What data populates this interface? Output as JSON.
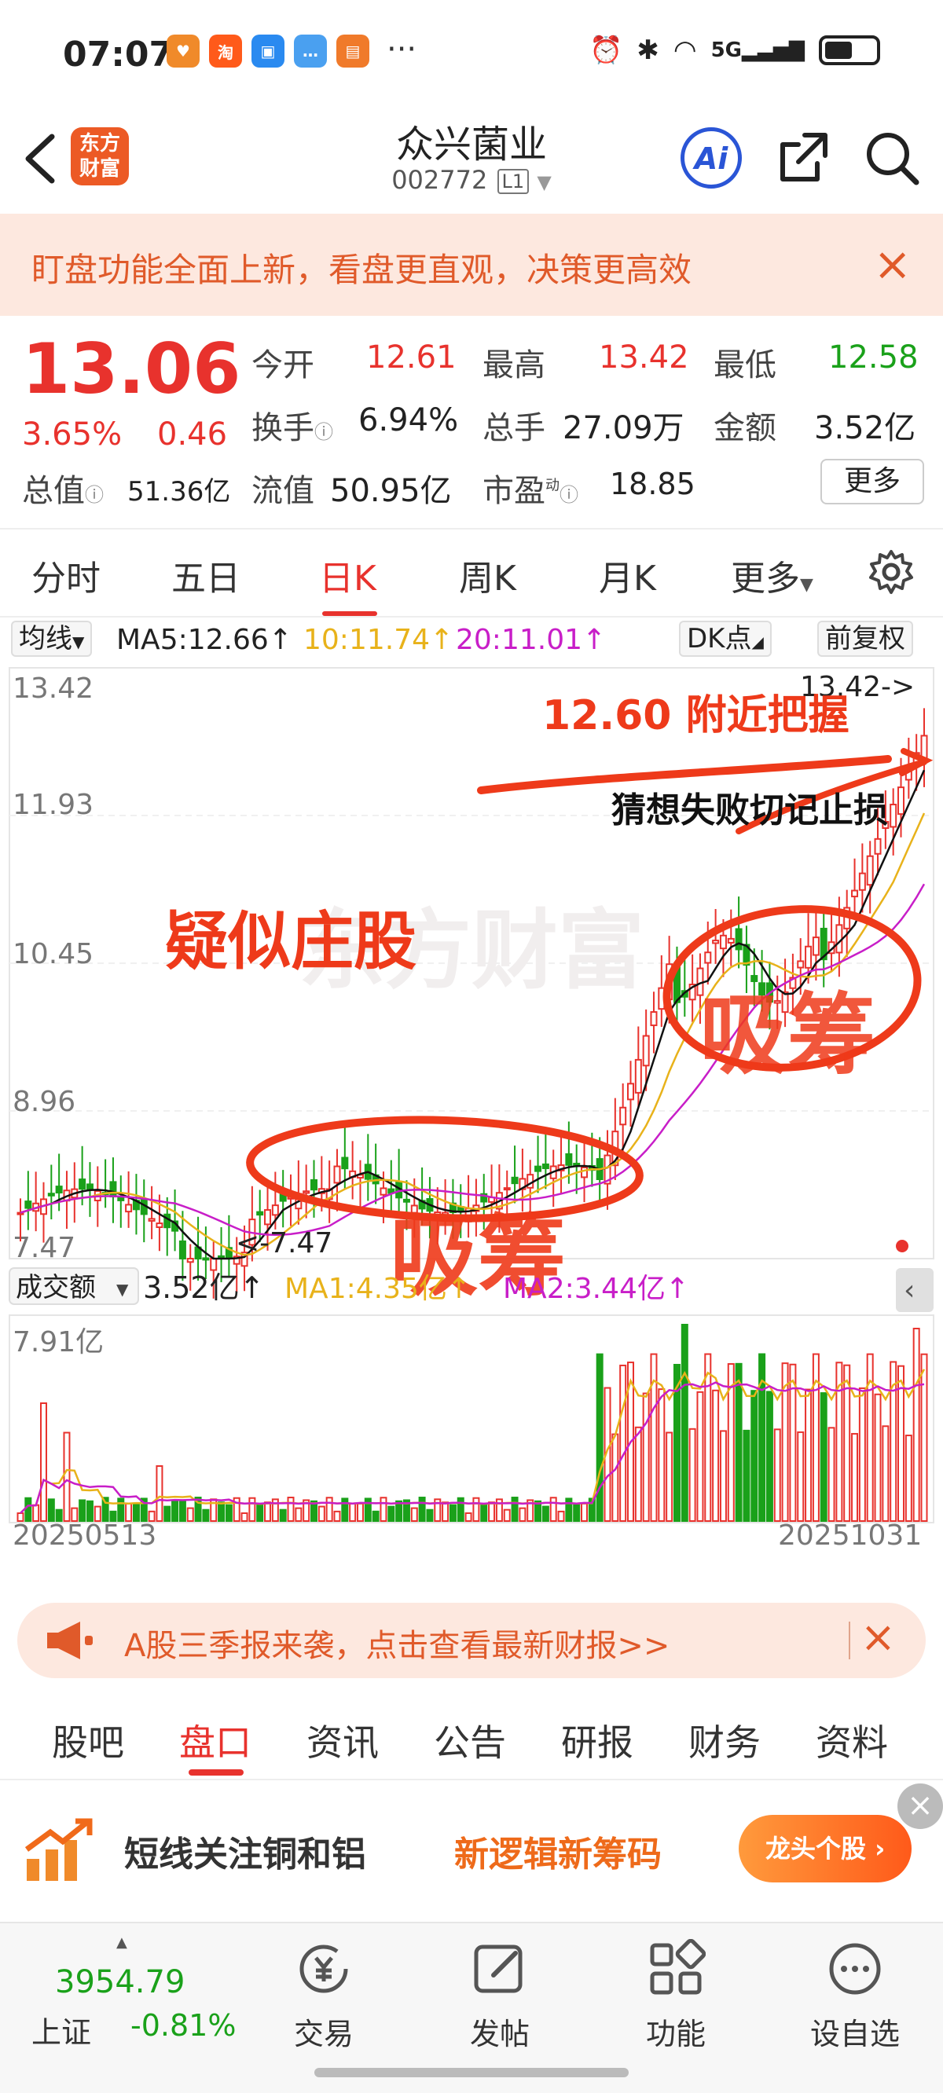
{
  "status_bar": {
    "time": "07:07",
    "more": "···",
    "network": "5G"
  },
  "header": {
    "logo_line1": "东方",
    "logo_line2": "财富",
    "stock_name": "众兴菌业",
    "stock_code": "002772",
    "level_tag": "L1"
  },
  "notice": {
    "text": "盯盘功能全面上新，看盘更直观，决策更高效",
    "close": "×"
  },
  "quote": {
    "price": "13.06",
    "change_pct": "3.65%",
    "change": "0.46",
    "open_label": "今开",
    "open": "12.61",
    "high_label": "最高",
    "high": "13.42",
    "low_label": "最低",
    "low": "12.58",
    "turnover_label": "换手",
    "turnover": "6.94%",
    "volume_label": "总手",
    "volume": "27.09万",
    "amount_label": "金额",
    "amount": "3.52亿",
    "total_value_label": "总值",
    "total_value": "51.36亿",
    "float_value_label": "流值",
    "float_value": "50.95亿",
    "pe_label": "市盈",
    "pe_sup": "动",
    "pe": "18.85",
    "more_button": "更多"
  },
  "period_tabs": [
    "分时",
    "五日",
    "日K",
    "周K",
    "月K",
    "更多"
  ],
  "active_period": "日K",
  "ma_bar": {
    "selector": "均线",
    "ma5": "MA5:12.66↑",
    "ma10": "10:11.74↑",
    "ma20": "20:11.01↑",
    "dk": "DK点",
    "adjust": "前复权"
  },
  "colors": {
    "up": "#e8322d",
    "down": "#1aa11a",
    "ma5": "#111111",
    "ma10": "#e8b21a",
    "ma20": "#c81ec8",
    "annotation": "#ee3a1a"
  },
  "chart_data": {
    "type": "candlestick",
    "y_ticks": [
      "13.42",
      "11.93",
      "10.45",
      "8.96",
      "7.47"
    ],
    "ylim": [
      7.47,
      13.42
    ],
    "max_label": "13.42->",
    "min_label": "<-7.47",
    "x_start": "20250513",
    "x_end": "20251031",
    "volume_panel": {
      "selector": "成交额",
      "current": "3.52亿↑",
      "ma1": "MA1:4.35亿↑",
      "ma2": "MA2:3.44亿↑",
      "max_label": "7.91亿"
    },
    "annotations": [
      "12.60 附近把握",
      "猜想失败切记止损",
      "疑似庄股",
      "吸筹",
      "吸筹"
    ],
    "watermark": "东方财富"
  },
  "banner": {
    "text": "A股三季报来袭，点击查看最新财报>>",
    "close": "×"
  },
  "bottom_tabs": [
    "股吧",
    "盘口",
    "资讯",
    "公告",
    "研报",
    "财务",
    "资料"
  ],
  "active_bottom_tab": "盘口",
  "ad": {
    "text1": "短线关注铜和铝",
    "text2": "新逻辑新筹码",
    "button": "龙头个股 ›",
    "close": "×"
  },
  "bottom_nav": {
    "index_value": "3954.79",
    "index_name": "上证",
    "index_change": "-0.81%",
    "items": [
      "交易",
      "发帖",
      "功能",
      "设自选"
    ]
  }
}
